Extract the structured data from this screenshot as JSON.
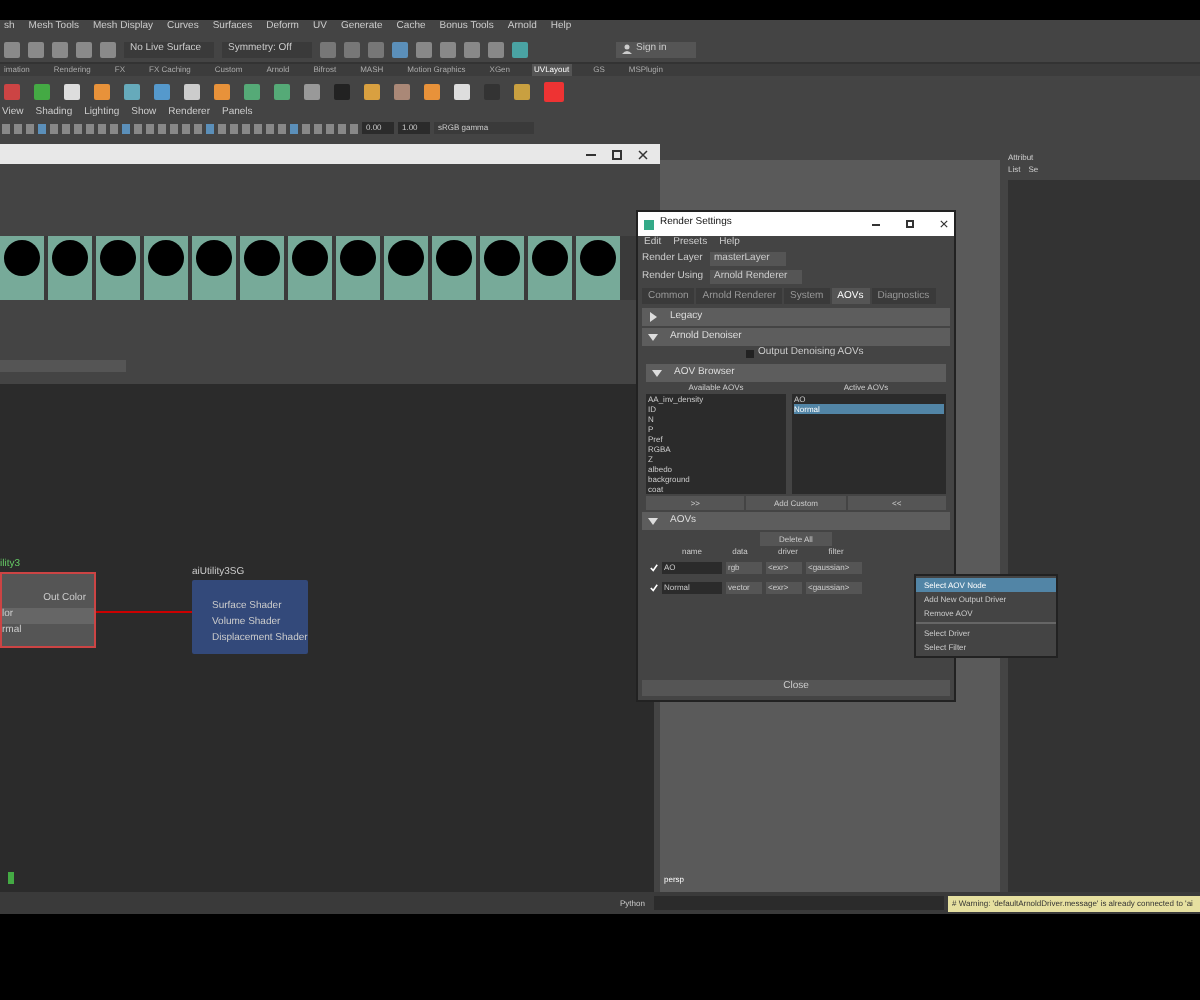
{
  "menu_bar": [
    "sh",
    "Mesh Tools",
    "Mesh Display",
    "Curves",
    "Surfaces",
    "Deform",
    "UV",
    "Generate",
    "Cache",
    "Bonus Tools",
    "Arnold",
    "Help"
  ],
  "status_line": {
    "live_surface": "No Live Surface",
    "symmetry": "Symmetry: Off",
    "sign_in": "Sign in"
  },
  "shelf_tabs": [
    {
      "label": "imation",
      "selected": false
    },
    {
      "label": "Rendering",
      "selected": false
    },
    {
      "label": "FX",
      "selected": false
    },
    {
      "label": "FX Caching",
      "selected": false
    },
    {
      "label": "Custom",
      "selected": false
    },
    {
      "label": "Arnold",
      "selected": false
    },
    {
      "label": "Bifrost",
      "selected": false
    },
    {
      "label": "MASH",
      "selected": false
    },
    {
      "label": "Motion Graphics",
      "selected": false
    },
    {
      "label": "XGen",
      "selected": false
    },
    {
      "label": "UVLayout",
      "selected": true
    },
    {
      "label": "GS",
      "selected": false
    },
    {
      "label": "MSPlugin",
      "selected": false
    }
  ],
  "panel_menu": [
    "View",
    "Shading",
    "Lighting",
    "Show",
    "Renderer",
    "Panels"
  ],
  "panel_toolbar": {
    "exposure": "0.00",
    "gamma": "1.00",
    "color_space": "sRGB gamma"
  },
  "node_editor": {
    "nodes": [
      {
        "title": "ility3",
        "ports": [
          "Out Color",
          "lor",
          "rmal"
        ]
      },
      {
        "title": "aiUtility3SG",
        "ports": [
          "Surface Shader",
          "Volume Shader",
          "Displacement Shader"
        ]
      }
    ]
  },
  "attribute_panel": {
    "title": "Attribut",
    "menu": [
      "List",
      "Se"
    ]
  },
  "render_settings": {
    "title": "Render Settings",
    "menu": [
      "Edit",
      "Presets",
      "Help"
    ],
    "render_layer": {
      "label": "Render Layer",
      "value": "masterLayer"
    },
    "render_using": {
      "label": "Render Using",
      "value": "Arnold Renderer"
    },
    "tabs": [
      {
        "label": "Common",
        "selected": false
      },
      {
        "label": "Arnold Renderer",
        "selected": false
      },
      {
        "label": "System",
        "selected": false
      },
      {
        "label": "AOVs",
        "selected": true
      },
      {
        "label": "Diagnostics",
        "selected": false
      }
    ],
    "sections": [
      {
        "label": "Legacy",
        "expanded": false
      },
      {
        "label": "Arnold Denoiser",
        "expanded": true
      }
    ],
    "denoise_checkbox": {
      "label": "Output Denoising AOVs",
      "checked": false
    },
    "aov_browser": {
      "label": "AOV Browser",
      "expanded": true,
      "available_header": "Available AOVs",
      "active_header": "Active AOVs",
      "available": [
        "AA_inv_density",
        "ID",
        "N",
        "P",
        "Pref",
        "RGBA",
        "Z",
        "albedo",
        "background",
        "coat"
      ],
      "active": [
        {
          "label": "AO",
          "selected": false
        },
        {
          "label": "Normal",
          "selected": true
        }
      ],
      "buttons": [
        ">>",
        "Add Custom",
        "<<"
      ]
    },
    "aovs": {
      "label": "AOVs",
      "expanded": true,
      "delete_all": "Delete All",
      "columns": [
        "name",
        "data",
        "driver",
        "filter"
      ],
      "rows": [
        {
          "checked": true,
          "name": "AO",
          "data": "rgb",
          "driver": "<exr>",
          "filter": "<gaussian>"
        },
        {
          "checked": true,
          "name": "Normal",
          "data": "vector",
          "driver": "<exr>",
          "filter": "<gaussian>"
        }
      ]
    },
    "close": "Close"
  },
  "context_menu": [
    {
      "label": "Select AOV Node",
      "selected": true,
      "divider_before": false
    },
    {
      "label": "Add New Output Driver",
      "selected": false,
      "divider_before": false
    },
    {
      "label": "Remove AOV",
      "selected": false,
      "divider_before": false
    },
    {
      "label": "Select Driver",
      "selected": false,
      "divider_before": true
    },
    {
      "label": "Select Filter",
      "selected": false,
      "divider_before": false
    }
  ],
  "viewport": {
    "camera": "persp"
  },
  "command_line": {
    "language": "Python",
    "warning": "# Warning: 'defaultArnoldDriver.message' is already connected to 'ai"
  }
}
